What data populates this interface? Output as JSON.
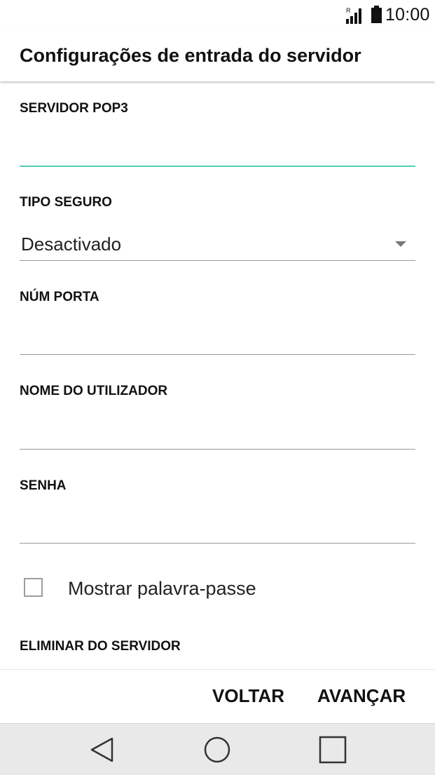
{
  "status_bar": {
    "time": "10:00",
    "roaming_indicator": "R",
    "icons": [
      "signal-icon",
      "battery-icon"
    ]
  },
  "app_bar": {
    "title": "Configurações de entrada do servidor"
  },
  "form": {
    "server": {
      "label": "SERVIDOR POP3",
      "value": ""
    },
    "security_type": {
      "label": "TIPO SEGURO",
      "value": "Desactivado"
    },
    "port": {
      "label": "NÚM PORTA",
      "value": ""
    },
    "username": {
      "label": "NOME DO UTILIZADOR",
      "value": ""
    },
    "password": {
      "label": "SENHA",
      "value": ""
    },
    "show_password": {
      "label": "Mostrar palavra-passe",
      "checked": false
    },
    "delete_from_server": {
      "label": "ELIMINAR DO SERVIDOR"
    }
  },
  "actions": {
    "back_label": "VOLTAR",
    "next_label": "AVANÇAR"
  },
  "nav_bar": {
    "icons": [
      "back-triangle-icon",
      "home-circle-icon",
      "recents-square-icon"
    ]
  },
  "colors": {
    "focus_accent": "#4fcfb4",
    "nav_background": "#e9e9ea",
    "divider": "#9a9a9a"
  }
}
